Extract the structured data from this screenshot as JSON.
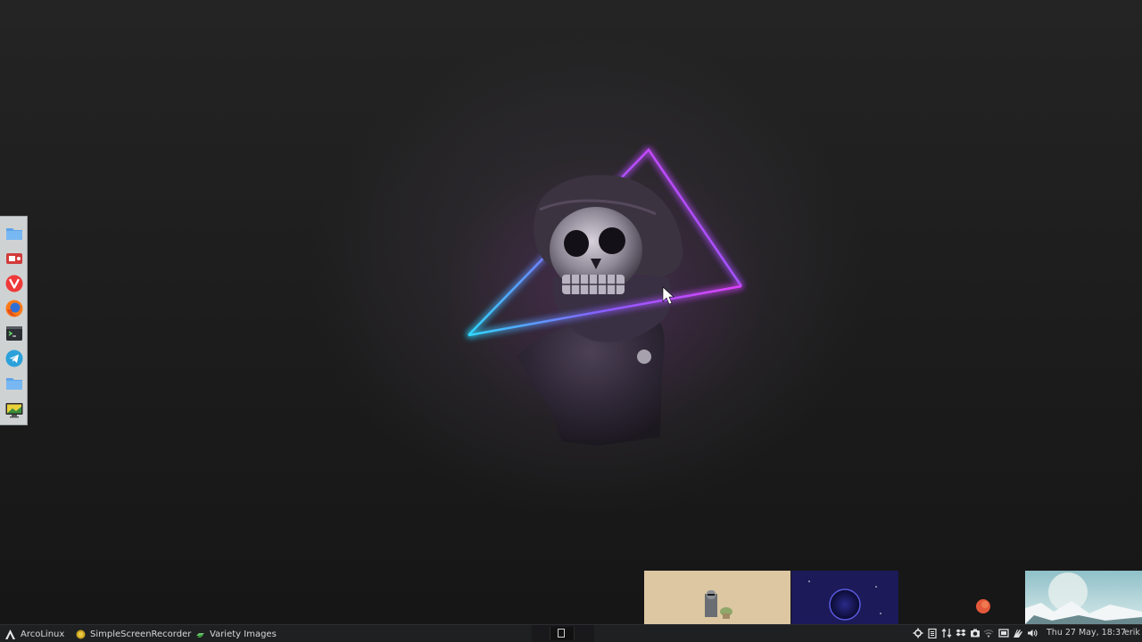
{
  "taskbar": {
    "start_label": "ArcoLinux",
    "windows": [
      {
        "label": "SimpleScreenRecorder",
        "icon": "screen-recorder-icon"
      },
      {
        "label": "Variety Images",
        "icon": "variety-icon"
      }
    ],
    "clock": "Thu 27 May, 18:37",
    "user": "erik"
  },
  "dock": {
    "items": [
      {
        "name": "files",
        "icon": "folder-icon"
      },
      {
        "name": "screen-recorder",
        "icon": "screen-recorder-icon"
      },
      {
        "name": "vivaldi",
        "icon": "vivaldi-icon"
      },
      {
        "name": "firefox",
        "icon": "firefox-icon"
      },
      {
        "name": "terminal",
        "icon": "terminal-icon"
      },
      {
        "name": "telegram",
        "icon": "telegram-icon"
      },
      {
        "name": "home-folder",
        "icon": "folder-icon"
      },
      {
        "name": "display-settings",
        "icon": "monitor-icon"
      }
    ]
  },
  "variety_thumbnails": [
    {
      "name": "mandalorian-grogu",
      "bg": "#dcc7a2"
    },
    {
      "name": "purple-planet",
      "bg": "#1a1850"
    },
    {
      "name": "red-moon",
      "bg": "#161616"
    },
    {
      "name": "ice-planet-landscape",
      "bg": "#b8d4d8"
    }
  ],
  "tray_icons": [
    "settings-icon",
    "clipboard-icon",
    "network-transfer-icon",
    "dropbox-icon",
    "camera-icon",
    "wifi-icon",
    "window-icon",
    "hand-icon",
    "volume-icon"
  ],
  "colors": {
    "taskbar_bg": "#1f2022",
    "dock_bg": "#cfd2d3",
    "neon_magenta": "#e040ff",
    "neon_cyan": "#30d8ff"
  }
}
